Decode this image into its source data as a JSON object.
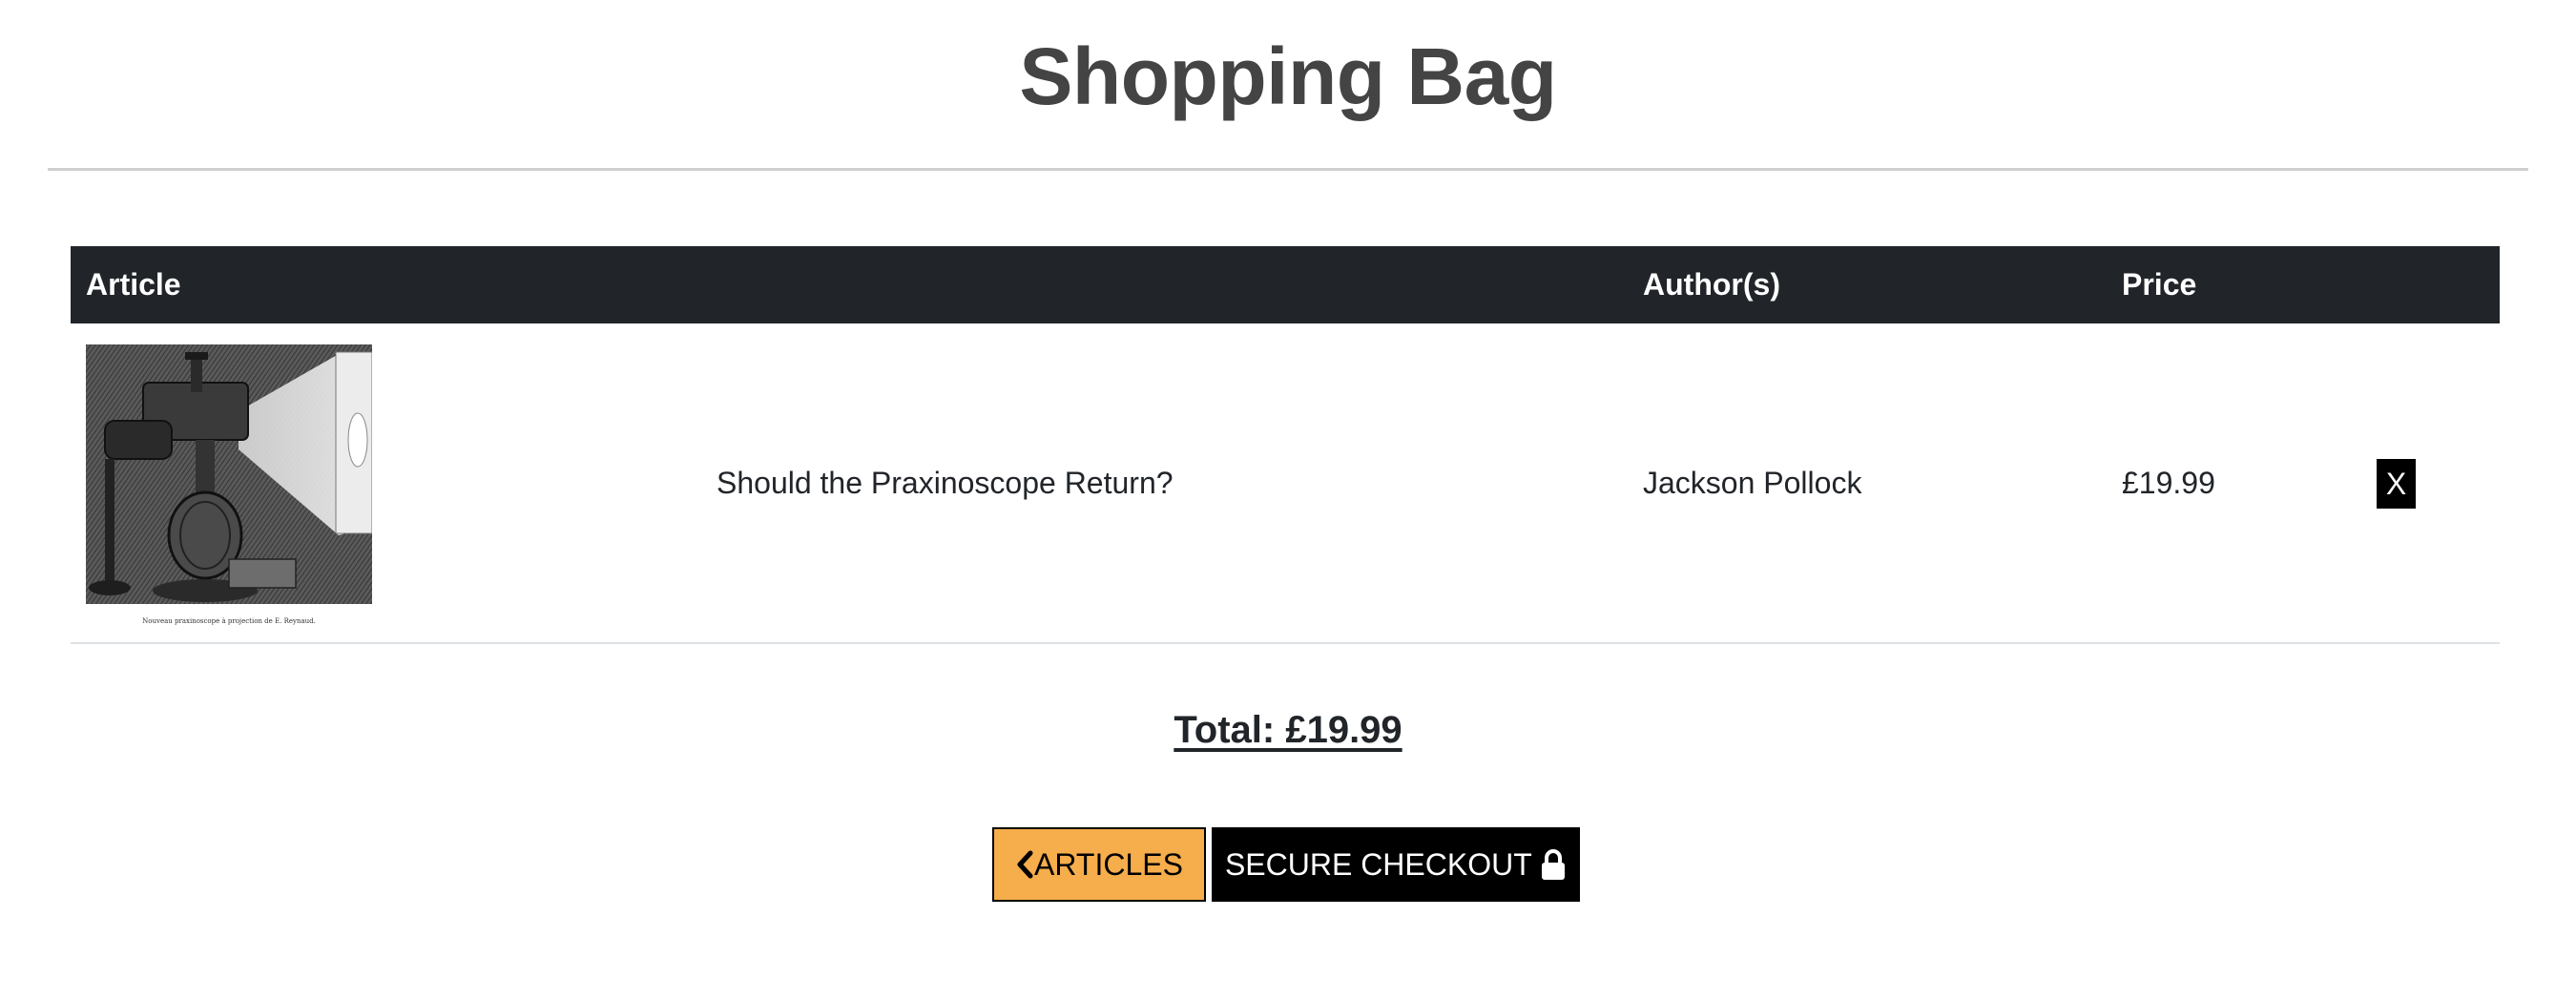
{
  "page": {
    "title": "Shopping Bag"
  },
  "table": {
    "headers": {
      "article": "Article",
      "authors": "Author(s)",
      "price": "Price"
    },
    "rows": [
      {
        "thumbnail": {
          "icon": "praxinoscope-engraving-image",
          "caption": "Nouveau praxinoscope à projection de E. Reynaud."
        },
        "title": "Should the Praxinoscope Return?",
        "author": "Jackson Pollock",
        "price": "£19.99",
        "remove_label": "X"
      }
    ]
  },
  "summary": {
    "total": "Total: £19.99"
  },
  "actions": {
    "articles_label": "ARTICLES",
    "articles_icon": "chevron-left-icon",
    "checkout_label": "SECURE CHECKOUT",
    "checkout_icon": "lock-icon"
  },
  "colors": {
    "header_bg": "#212529",
    "articles_button_bg": "#f6ad4b",
    "checkout_button_bg": "#000000",
    "remove_button_bg": "#000000",
    "title_color": "#444444"
  }
}
